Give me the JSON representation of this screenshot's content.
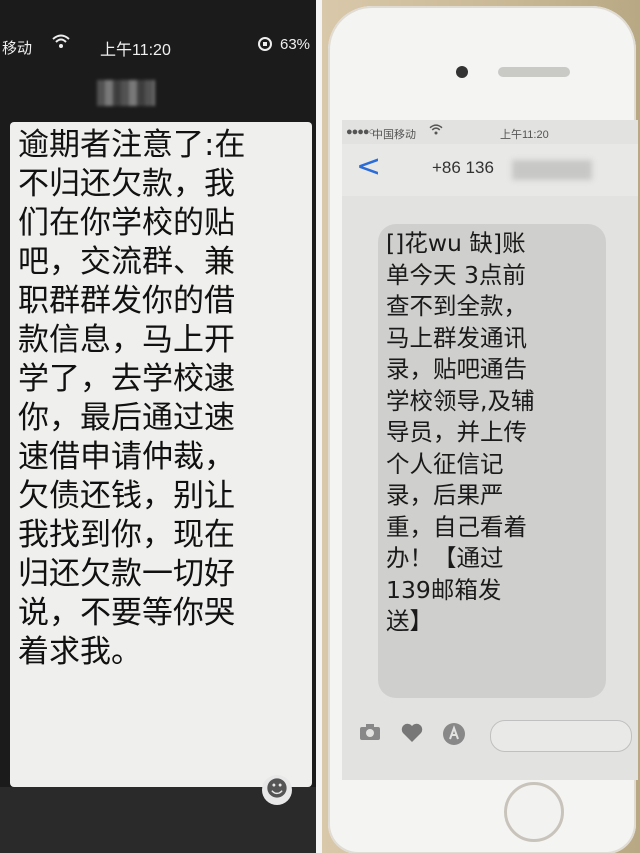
{
  "left_phone": {
    "status_bar": {
      "carrier": "移动",
      "time": "上午11:20",
      "battery": "63%"
    },
    "message_lines": [
      "逾期者注意了:在",
      "不归还欠款，我",
      "们在你学校的贴",
      "吧，交流群、兼",
      "职群群发你的借",
      "款信息，马上开",
      "学了，去学校逮",
      "你，最后通过速",
      "速借申请仲裁，",
      "欠债还钱，别让",
      "我找到你，现在",
      "归还欠款一切好",
      "说，不要等你哭",
      "着求我。"
    ]
  },
  "right_phone": {
    "status_bar": {
      "signal": "●●●●○",
      "carrier": "中国移动",
      "time": "上午11:20"
    },
    "header": {
      "back": "<",
      "sender": "+86 136"
    },
    "message_lines": [
      "[]花wu  缺]账",
      "单今天 3点前",
      "查不到全款，",
      "马上群发通讯",
      "录，贴吧通告",
      "学校领导,及辅",
      "导员，并上传",
      "个人征信记",
      "录，后果严",
      "重，自己看着",
      "办！【通过",
      "139邮箱发",
      "送】"
    ]
  },
  "icons": {
    "emoji": "emoji-icon",
    "camera": "camera-icon",
    "heart": "heart-icon",
    "appstore": "appstore-icon",
    "wifi": "wifi-icon",
    "lock": "rotation-lock-icon"
  }
}
